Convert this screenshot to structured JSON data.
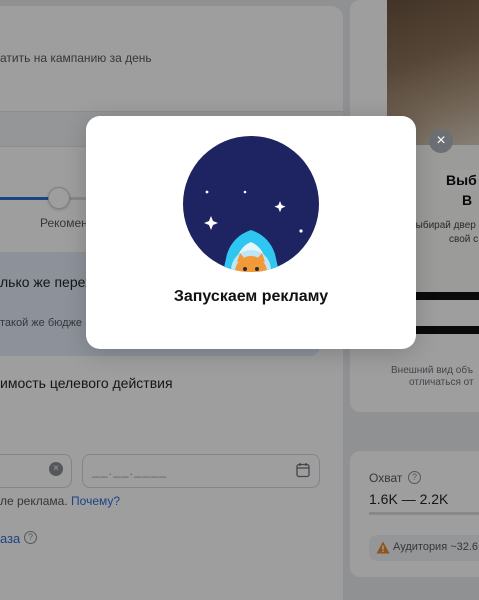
{
  "background": {
    "left_panel": {
      "budget_hint": "атить на кампанию за день",
      "slider_label": "Рекомен",
      "info_title": "лько же перехо",
      "info_sub": "такой же бюдже",
      "cost_label": "имость целевого действия",
      "date_placeholder": "__.__.____",
      "why_text": "ле реклама.",
      "why_link": "Почему?",
      "bottom_link": "аза"
    },
    "preview": {
      "bold_line1": "Выб",
      "bold_line2": "В",
      "text_line1": "Выбирай двер",
      "text_line2": "свой с",
      "note_line1": "Внешний вид объ",
      "note_line2": "отличаться от"
    },
    "reach": {
      "title": "Охват",
      "value": "1.6K — 2.2K",
      "warning": "Аудитория ~32.6"
    }
  },
  "modal": {
    "title": "Запускаем рекламу",
    "icon": "rocket-cat-icon"
  },
  "colors": {
    "accent": "#2d6fd6",
    "illustration_bg": "#1d2461",
    "rocket_fin": "#2fc6f2",
    "cat": "#f29a3a"
  }
}
